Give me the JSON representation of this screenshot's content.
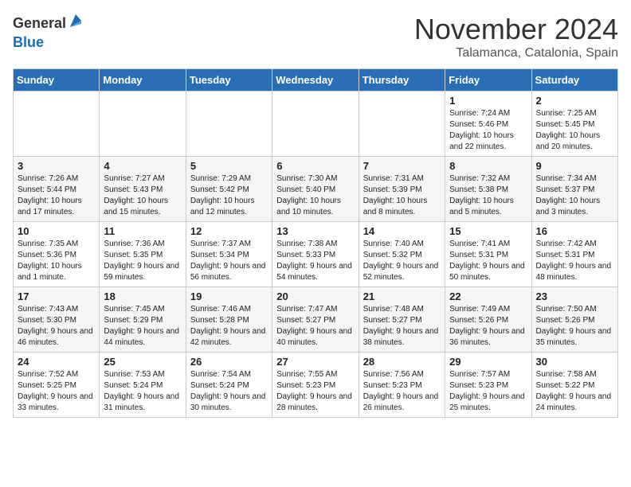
{
  "logo": {
    "general": "General",
    "blue": "Blue"
  },
  "title": "November 2024",
  "location": "Talamanca, Catalonia, Spain",
  "days_of_week": [
    "Sunday",
    "Monday",
    "Tuesday",
    "Wednesday",
    "Thursday",
    "Friday",
    "Saturday"
  ],
  "weeks": [
    [
      {
        "day": "",
        "info": ""
      },
      {
        "day": "",
        "info": ""
      },
      {
        "day": "",
        "info": ""
      },
      {
        "day": "",
        "info": ""
      },
      {
        "day": "",
        "info": ""
      },
      {
        "day": "1",
        "info": "Sunrise: 7:24 AM\nSunset: 5:46 PM\nDaylight: 10 hours\nand 22 minutes."
      },
      {
        "day": "2",
        "info": "Sunrise: 7:25 AM\nSunset: 5:45 PM\nDaylight: 10 hours\nand 20 minutes."
      }
    ],
    [
      {
        "day": "3",
        "info": "Sunrise: 7:26 AM\nSunset: 5:44 PM\nDaylight: 10 hours\nand 17 minutes."
      },
      {
        "day": "4",
        "info": "Sunrise: 7:27 AM\nSunset: 5:43 PM\nDaylight: 10 hours\nand 15 minutes."
      },
      {
        "day": "5",
        "info": "Sunrise: 7:29 AM\nSunset: 5:42 PM\nDaylight: 10 hours\nand 12 minutes."
      },
      {
        "day": "6",
        "info": "Sunrise: 7:30 AM\nSunset: 5:40 PM\nDaylight: 10 hours\nand 10 minutes."
      },
      {
        "day": "7",
        "info": "Sunrise: 7:31 AM\nSunset: 5:39 PM\nDaylight: 10 hours\nand 8 minutes."
      },
      {
        "day": "8",
        "info": "Sunrise: 7:32 AM\nSunset: 5:38 PM\nDaylight: 10 hours\nand 5 minutes."
      },
      {
        "day": "9",
        "info": "Sunrise: 7:34 AM\nSunset: 5:37 PM\nDaylight: 10 hours\nand 3 minutes."
      }
    ],
    [
      {
        "day": "10",
        "info": "Sunrise: 7:35 AM\nSunset: 5:36 PM\nDaylight: 10 hours\nand 1 minute."
      },
      {
        "day": "11",
        "info": "Sunrise: 7:36 AM\nSunset: 5:35 PM\nDaylight: 9 hours\nand 59 minutes."
      },
      {
        "day": "12",
        "info": "Sunrise: 7:37 AM\nSunset: 5:34 PM\nDaylight: 9 hours\nand 56 minutes."
      },
      {
        "day": "13",
        "info": "Sunrise: 7:38 AM\nSunset: 5:33 PM\nDaylight: 9 hours\nand 54 minutes."
      },
      {
        "day": "14",
        "info": "Sunrise: 7:40 AM\nSunset: 5:32 PM\nDaylight: 9 hours\nand 52 minutes."
      },
      {
        "day": "15",
        "info": "Sunrise: 7:41 AM\nSunset: 5:31 PM\nDaylight: 9 hours\nand 50 minutes."
      },
      {
        "day": "16",
        "info": "Sunrise: 7:42 AM\nSunset: 5:31 PM\nDaylight: 9 hours\nand 48 minutes."
      }
    ],
    [
      {
        "day": "17",
        "info": "Sunrise: 7:43 AM\nSunset: 5:30 PM\nDaylight: 9 hours\nand 46 minutes."
      },
      {
        "day": "18",
        "info": "Sunrise: 7:45 AM\nSunset: 5:29 PM\nDaylight: 9 hours\nand 44 minutes."
      },
      {
        "day": "19",
        "info": "Sunrise: 7:46 AM\nSunset: 5:28 PM\nDaylight: 9 hours\nand 42 minutes."
      },
      {
        "day": "20",
        "info": "Sunrise: 7:47 AM\nSunset: 5:27 PM\nDaylight: 9 hours\nand 40 minutes."
      },
      {
        "day": "21",
        "info": "Sunrise: 7:48 AM\nSunset: 5:27 PM\nDaylight: 9 hours\nand 38 minutes."
      },
      {
        "day": "22",
        "info": "Sunrise: 7:49 AM\nSunset: 5:26 PM\nDaylight: 9 hours\nand 36 minutes."
      },
      {
        "day": "23",
        "info": "Sunrise: 7:50 AM\nSunset: 5:26 PM\nDaylight: 9 hours\nand 35 minutes."
      }
    ],
    [
      {
        "day": "24",
        "info": "Sunrise: 7:52 AM\nSunset: 5:25 PM\nDaylight: 9 hours\nand 33 minutes."
      },
      {
        "day": "25",
        "info": "Sunrise: 7:53 AM\nSunset: 5:24 PM\nDaylight: 9 hours\nand 31 minutes."
      },
      {
        "day": "26",
        "info": "Sunrise: 7:54 AM\nSunset: 5:24 PM\nDaylight: 9 hours\nand 30 minutes."
      },
      {
        "day": "27",
        "info": "Sunrise: 7:55 AM\nSunset: 5:23 PM\nDaylight: 9 hours\nand 28 minutes."
      },
      {
        "day": "28",
        "info": "Sunrise: 7:56 AM\nSunset: 5:23 PM\nDaylight: 9 hours\nand 26 minutes."
      },
      {
        "day": "29",
        "info": "Sunrise: 7:57 AM\nSunset: 5:23 PM\nDaylight: 9 hours\nand 25 minutes."
      },
      {
        "day": "30",
        "info": "Sunrise: 7:58 AM\nSunset: 5:22 PM\nDaylight: 9 hours\nand 24 minutes."
      }
    ]
  ]
}
